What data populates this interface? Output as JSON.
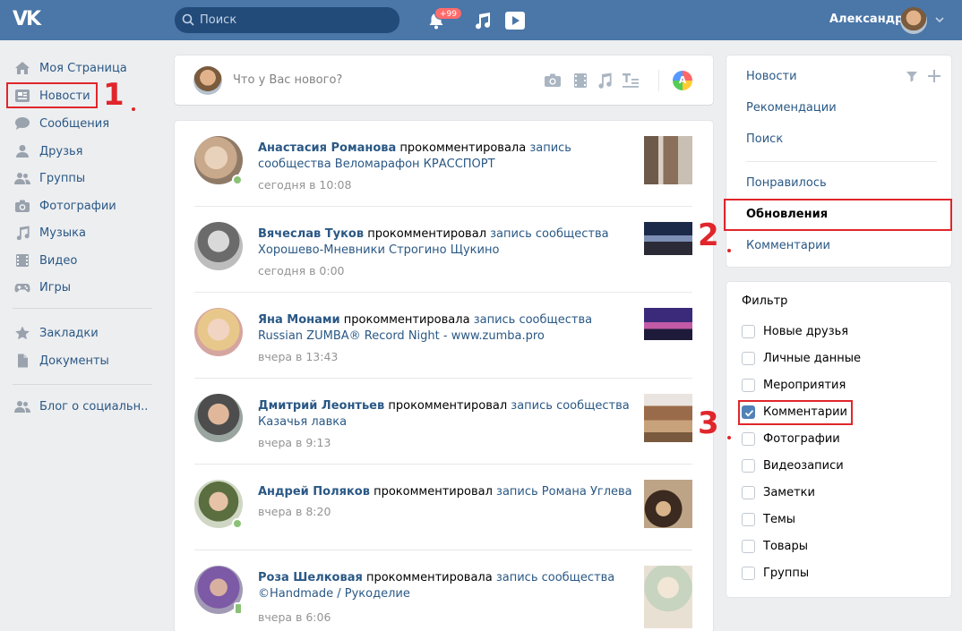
{
  "header": {
    "logo": "VK",
    "search_placeholder": "Поиск",
    "notifications_badge": "+99",
    "user_name": "Александр"
  },
  "nav": {
    "items": [
      {
        "label": "Моя Страница",
        "icon": "home-icon"
      },
      {
        "label": "Новости",
        "icon": "news-icon"
      },
      {
        "label": "Сообщения",
        "icon": "messages-icon"
      },
      {
        "label": "Друзья",
        "icon": "friends-icon"
      },
      {
        "label": "Группы",
        "icon": "groups-icon"
      },
      {
        "label": "Фотографии",
        "icon": "camera-icon"
      },
      {
        "label": "Музыка",
        "icon": "music-icon"
      },
      {
        "label": "Видео",
        "icon": "film-icon"
      },
      {
        "label": "Игры",
        "icon": "gamepad-icon"
      },
      {
        "label": "Закладки",
        "icon": "star-icon"
      },
      {
        "label": "Документы",
        "icon": "document-icon"
      },
      {
        "label": "Блог о социальн..",
        "icon": "group-icon"
      }
    ]
  },
  "annotations": {
    "n1": "1",
    "n2": "2",
    "n3": "3"
  },
  "composer": {
    "placeholder": "Что у Вас нового?",
    "a_icon_letter": "A"
  },
  "feed": {
    "posts": [
      {
        "author": "Анастасия Романова",
        "action": " прокомментировала ",
        "link": "запись сообщества Веломарафон КРАССПОРТ",
        "time": "сегодня в 10:08"
      },
      {
        "author": "Вячеслав Туков",
        "action": " прокомментировал ",
        "link": "запись сообщества Хорошево-Мневники Строгино Щукино",
        "time": "сегодня в 0:00"
      },
      {
        "author": "Яна Монами",
        "action": " прокомментировала ",
        "link": "запись сообщества Russian ZUMBA® Record Night - www.zumba.pro",
        "time": "вчера в 13:43"
      },
      {
        "author": "Дмитрий Леонтьев",
        "action": " прокомментировал ",
        "link": "запись сообщества Казачья лавка",
        "time": "вчера в 9:13"
      },
      {
        "author": "Андрей Поляков",
        "action": " прокомментировал ",
        "link": "запись Романа Углева",
        "time": "вчера в 8:20"
      },
      {
        "author": "Роза Шелковая",
        "action": " прокомментировала ",
        "link": "запись сообщества ©Handmade / Рукоделие",
        "time": "вчера в 6:06"
      }
    ]
  },
  "right_menu": {
    "items": [
      "Новости",
      "Рекомендации",
      "Поиск",
      "Понравилось",
      "Обновления",
      "Комментарии"
    ],
    "active": "Обновления"
  },
  "filter": {
    "title": "Фильтр",
    "options": [
      {
        "label": "Новые друзья",
        "checked": false
      },
      {
        "label": "Личные данные",
        "checked": false
      },
      {
        "label": "Мероприятия",
        "checked": false
      },
      {
        "label": "Комментарии",
        "checked": true
      },
      {
        "label": "Фотографии",
        "checked": false
      },
      {
        "label": "Видеозаписи",
        "checked": false
      },
      {
        "label": "Заметки",
        "checked": false
      },
      {
        "label": "Темы",
        "checked": false
      },
      {
        "label": "Товары",
        "checked": false
      },
      {
        "label": "Группы",
        "checked": false
      }
    ]
  },
  "colors": {
    "header": "#4a76a8",
    "link": "#2a5885",
    "annotation_red": "#e0262b",
    "checkbox_checked": "#5181b8"
  }
}
